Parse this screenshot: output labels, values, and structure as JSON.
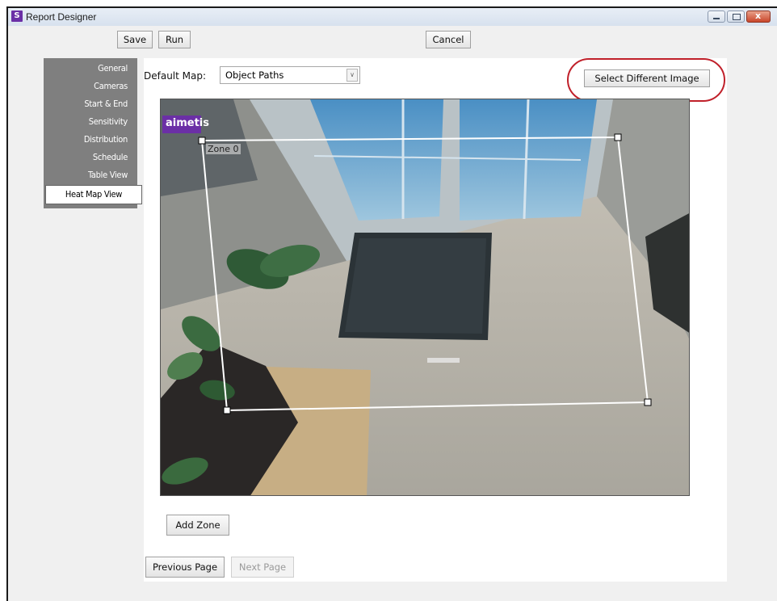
{
  "window": {
    "title": "Report Designer",
    "app_icon": "S"
  },
  "toolbar": {
    "save_label": "Save",
    "run_label": "Run",
    "cancel_label": "Cancel"
  },
  "nav": {
    "items": [
      {
        "label": "General"
      },
      {
        "label": "Cameras"
      },
      {
        "label": "Start & End"
      },
      {
        "label": "Sensitivity"
      },
      {
        "label": "Distribution"
      },
      {
        "label": "Schedule"
      },
      {
        "label": "Table View"
      },
      {
        "label": "Heat Map View",
        "active": true
      }
    ]
  },
  "main": {
    "default_map_label": "Default Map:",
    "default_map_value": "Object Paths",
    "select_image_label": "Select Different Image",
    "camera_logo": "aimetis",
    "zone_label": "Zone 0",
    "add_zone_label": "Add Zone"
  },
  "footer": {
    "previous_label": "Previous Page",
    "next_label": "Next Page"
  },
  "colors": {
    "nav_bg": "#7f7f7f",
    "highlight": "#c0202a",
    "logo": "#6b2fa6"
  }
}
